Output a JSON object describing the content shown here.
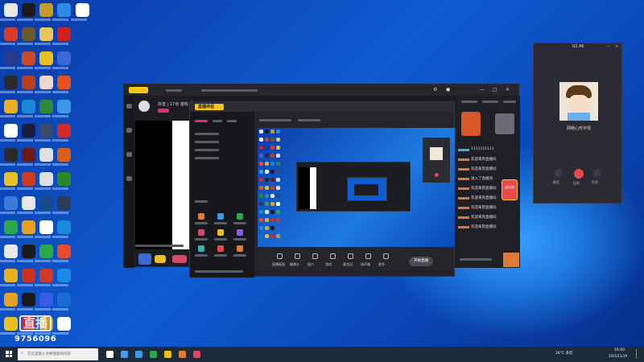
{
  "desktop": {
    "icon_colors": [
      [
        "#e8e8e8",
        "#1a1a1a",
        "#c89a2a",
        "#2b8be6",
        "#ffffff"
      ],
      [
        "#d63a2a",
        "#6b5a2a",
        "#e8c65a",
        "#d02020"
      ],
      [
        "#2a3a8a",
        "#c84a2a",
        "#e8c020",
        "#3a6ad8"
      ],
      [
        "#2a2a2a",
        "#b84020",
        "#f0d8d0",
        "#e85020"
      ],
      [
        "#e8b020",
        "#1a8ad8",
        "#2a8a3a",
        "#3a9ae8"
      ],
      [
        "#ffffff",
        "#1a1a3a",
        "#3a4a6a",
        "#d02a2a"
      ],
      [
        "#2a2a2a",
        "#6a1a1a",
        "#e0e0e0",
        "#d8601a"
      ],
      [
        "#e8c020",
        "#d03a20",
        "#e0e0e0",
        "#2a8a2a"
      ],
      [
        "#3a7ad8",
        "#e8e8e8",
        "#1a4a8a",
        "#2a3a5a"
      ],
      [
        "#2aa84a",
        "#e8a020",
        "#ffffff",
        "#1a8ad8"
      ],
      [
        "#e8e8e8",
        "#1a1a1a",
        "#2aa84a",
        "#e84a2a"
      ],
      [
        "#e8b020",
        "#d03020",
        "#d03a2a",
        "#1a8ae8"
      ],
      [
        "#e8a020",
        "#1a1a1a",
        "#3a5ae8",
        "#1a6ad8"
      ],
      [
        "#e8c020",
        "#d02a2a",
        "#c89a2a",
        "#ffffff"
      ]
    ]
  },
  "main_window": {
    "streamer_title_line": "抖音 | 17点 游戏",
    "menu_items": [
      "推荐",
      "直播",
      "游戏"
    ],
    "inner_title": "直播伴侣",
    "tools": [
      "直播画面",
      "摄像头",
      "窗口",
      "游戏",
      "麦克风",
      "扬声器",
      "更多"
    ],
    "start_button": "开始直播",
    "chat_messages": [
      "1111111111",
      "欢迎来到直播间",
      "欢迎来到直播间",
      "进入了直播间",
      "欢迎来到直播间",
      "欢迎来到直播间",
      "欢迎来到直播间",
      "欢迎来到直播间",
      "欢迎来到直播间"
    ],
    "gift_badge_text": "送礼物"
  },
  "call_window": {
    "time": "02:46",
    "caller": "网络心形字母",
    "buttons": [
      "静音",
      "挂断",
      "免提"
    ]
  },
  "overlay": {
    "room_number": "9756096"
  },
  "taskbar": {
    "search_placeholder": "在这里输入你要搜索的内容",
    "weather": "26°C 多云",
    "clock_time": "16:00",
    "clock_date": "2021/11/19"
  }
}
